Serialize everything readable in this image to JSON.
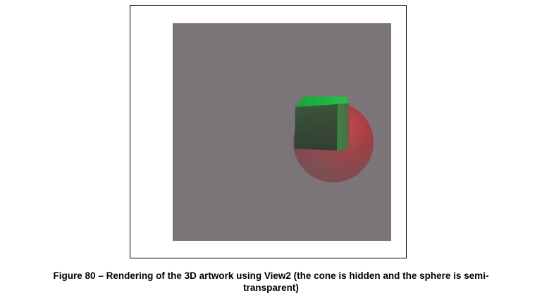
{
  "figure": {
    "caption_line1": "Figure 80 –  Rendering of the 3D artwork using View2 (the cone is hidden and the sphere is semi-",
    "caption_line2": "transparent)"
  },
  "colors": {
    "viewport_background": "#7b7478",
    "cube_green": "#2f7a3a",
    "sphere_red": "#b23a3f"
  }
}
